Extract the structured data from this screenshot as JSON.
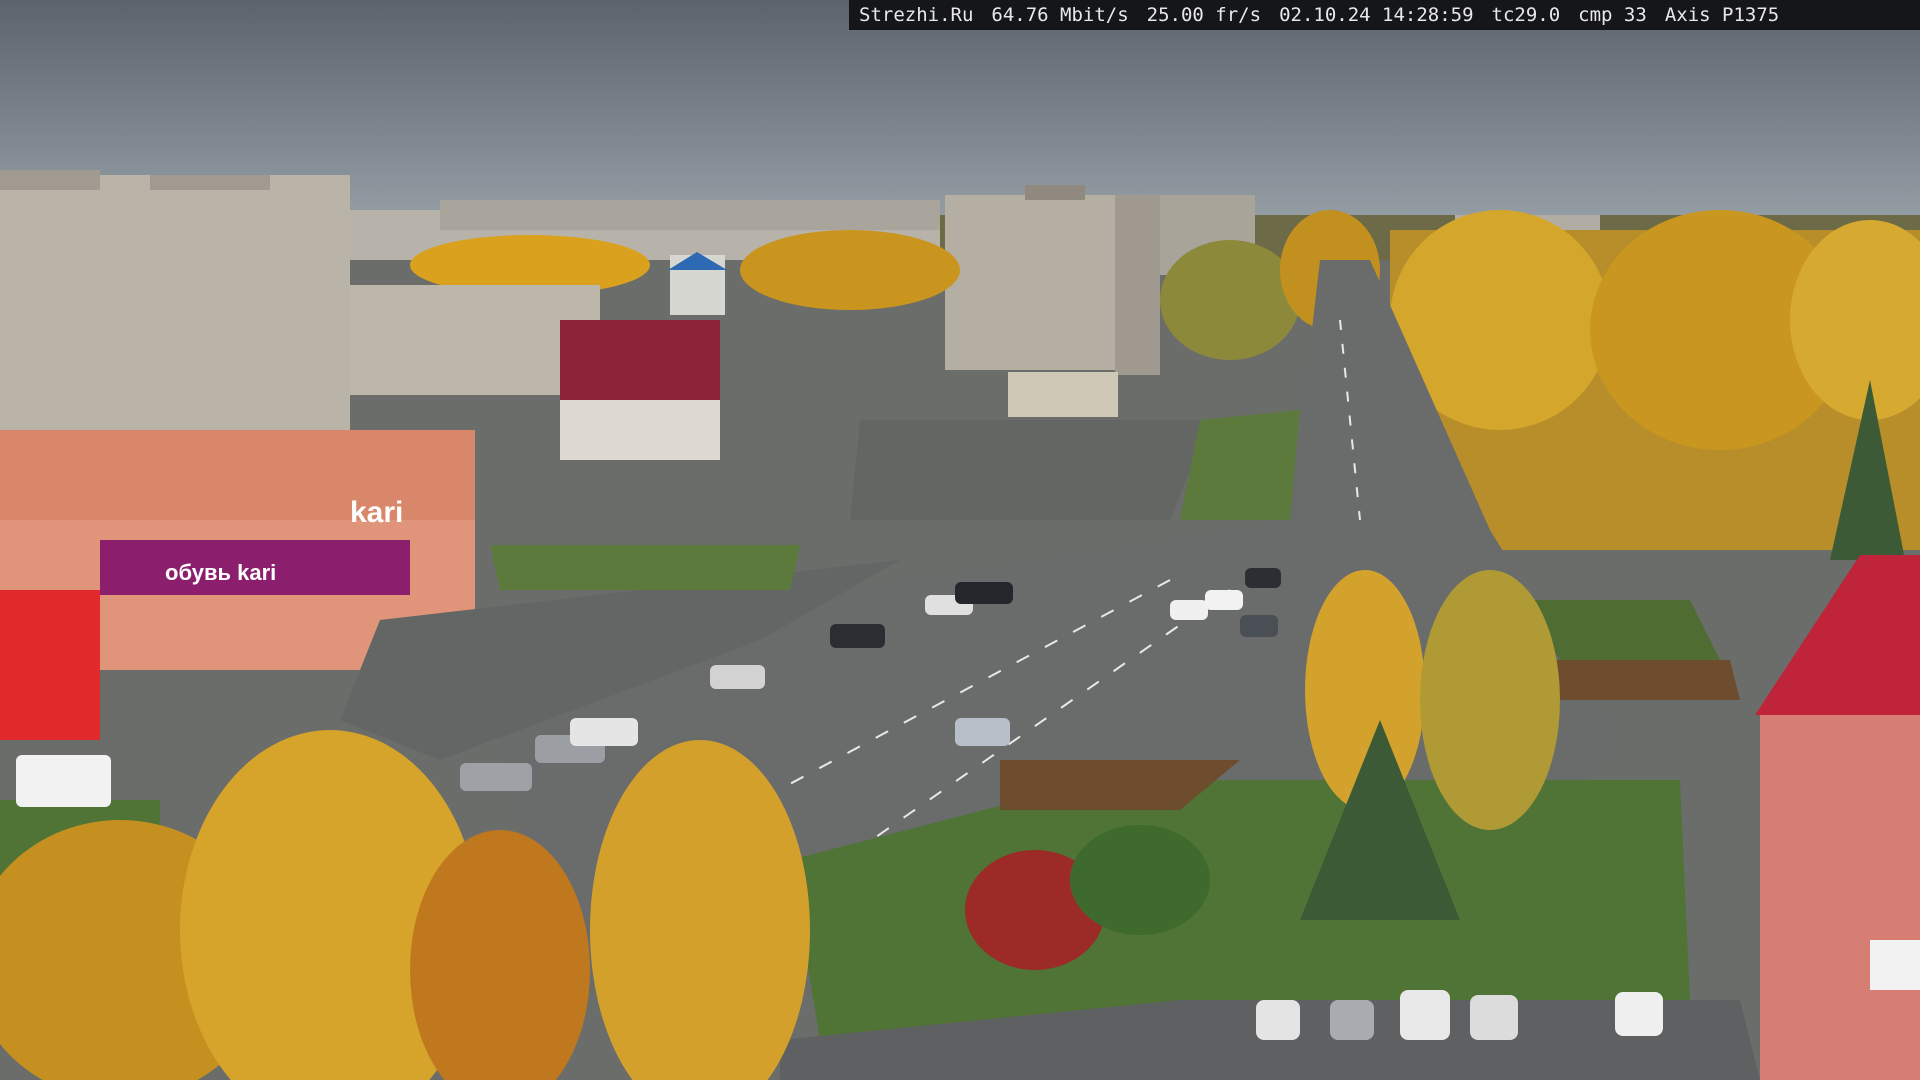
{
  "overlay": {
    "site": "Strezhi.Ru",
    "bitrate": "64.76 Mbit/s",
    "framerate": "25.00 fr/s",
    "datetime": "02.10.24 14:28:59",
    "tc": "tc29.0",
    "cmp": "cmp 33",
    "camera": "Axis P1375"
  },
  "signs": {
    "store_logo": "kari",
    "store_banner": "обувь kari",
    "colors": {
      "store": "#8b1f6e",
      "roof": "#c0243a",
      "foliage": "#d9a11e"
    }
  }
}
